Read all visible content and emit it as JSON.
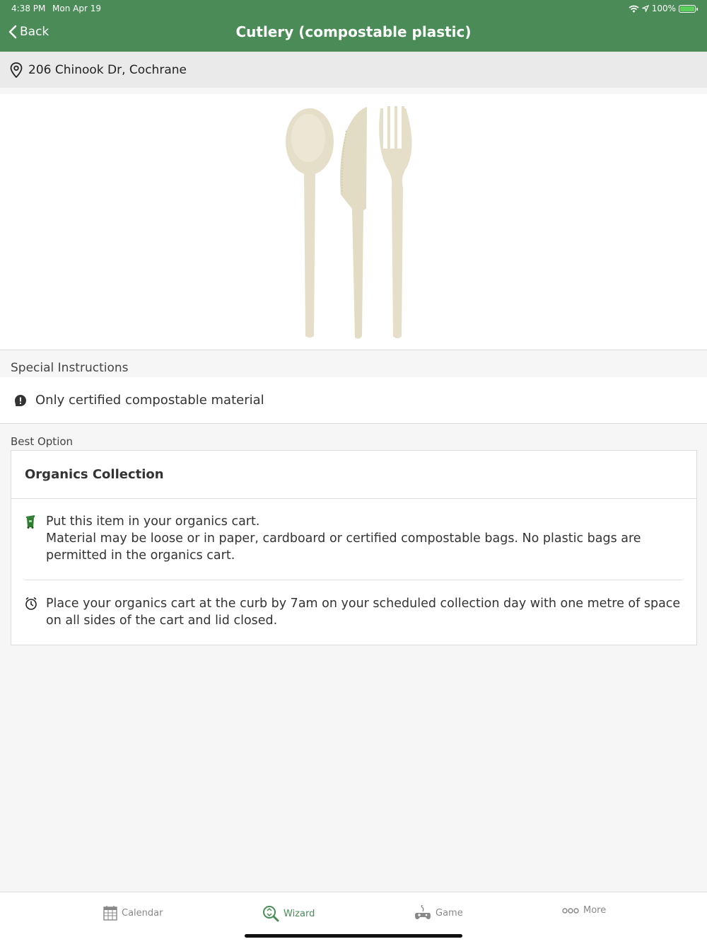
{
  "status_bar": {
    "time": "4:38 PM",
    "date": "Mon Apr 19",
    "battery": "100%"
  },
  "nav": {
    "back_label": "Back",
    "title": "Cutlery (compostable plastic)"
  },
  "location": {
    "address": "206 Chinook Dr, Cochrane"
  },
  "special_instructions": {
    "heading": "Special Instructions",
    "text": "Only certified compostable material"
  },
  "best_option": {
    "heading": "Best Option",
    "title": "Organics Collection",
    "line1": "Put this item in your organics cart.",
    "line2": "Material may be loose or in paper, cardboard or certified compostable bags.  No plastic bags are permitted in the organics cart.",
    "line3": "Place your organics cart at the curb by 7am on your scheduled collection day with one metre of space on all sides of the cart and lid closed."
  },
  "tabs": [
    {
      "label": "Calendar",
      "icon": "calendar-icon"
    },
    {
      "label": "Wizard",
      "icon": "wizard-icon"
    },
    {
      "label": "Game",
      "icon": "game-icon"
    },
    {
      "label": "More",
      "icon": "more-icon"
    }
  ],
  "colors": {
    "header_green": "#4a8b57",
    "active_tab": "#4a8b57",
    "cart_green": "#2e7d32"
  }
}
